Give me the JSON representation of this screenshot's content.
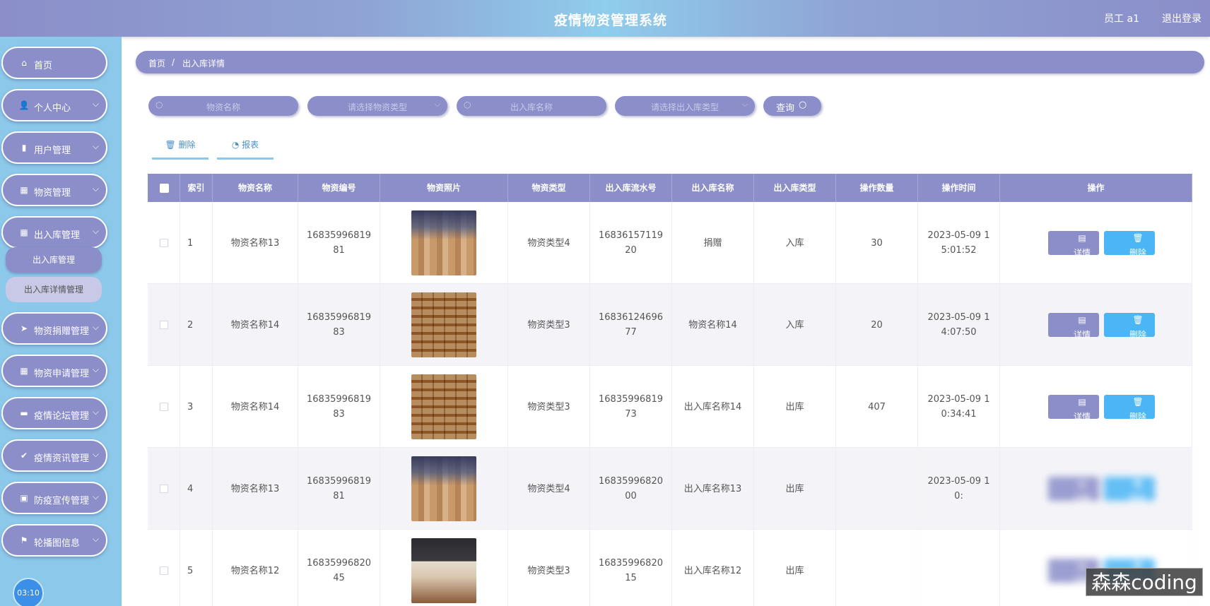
{
  "header": {
    "title": "疫情物资管理系统",
    "user": "员工 a1",
    "logout": "退出登录"
  },
  "sidebar": {
    "items": [
      {
        "label": "首页",
        "icon": "home-icon",
        "glyph": "⌂",
        "has_children": false
      },
      {
        "label": "个人中心",
        "icon": "person-icon",
        "glyph": "👤",
        "has_children": true
      },
      {
        "label": "用户管理",
        "icon": "bar-chart-icon",
        "glyph": "▮",
        "has_children": true
      },
      {
        "label": "物资管理",
        "icon": "grid-icon",
        "glyph": "▦",
        "has_children": true
      },
      {
        "label": "出入库管理",
        "icon": "grid-icon",
        "glyph": "▦",
        "has_children": true
      },
      {
        "label": "物资捐赠管理",
        "icon": "send-icon",
        "glyph": "➤",
        "has_children": true
      },
      {
        "label": "物资申请管理",
        "icon": "grid-icon",
        "glyph": "▦",
        "has_children": true
      },
      {
        "label": "疫情论坛管理",
        "icon": "monitor-icon",
        "glyph": "▬",
        "has_children": true
      },
      {
        "label": "疫情资讯管理",
        "icon": "thumb-icon",
        "glyph": "✔",
        "has_children": true
      },
      {
        "label": "防疫宣传管理",
        "icon": "briefcase-icon",
        "glyph": "▣",
        "has_children": true
      },
      {
        "label": "轮播图信息",
        "icon": "flag-icon",
        "glyph": "⚑",
        "has_children": true
      }
    ],
    "submenu": {
      "active": "出入库管理",
      "selected": "出入库详情管理"
    },
    "clock": "03:10"
  },
  "breadcrumb": {
    "home": "首页",
    "sep": "/",
    "current": "出入库详情"
  },
  "search": {
    "material_name_placeholder": "物资名称",
    "material_type_placeholder": "请选择物资类型",
    "io_name_placeholder": "出入库名称",
    "io_type_placeholder": "请选择出入库类型",
    "query_label": "查询"
  },
  "toolbar": {
    "delete_label": "删除",
    "report_label": "报表"
  },
  "table": {
    "columns": [
      "索引",
      "物资名称",
      "物资编号",
      "物资照片",
      "物资类型",
      "出入库流水号",
      "出入库名称",
      "出入库类型",
      "操作数量",
      "操作时间",
      "操作"
    ],
    "rows": [
      {
        "index": "1",
        "name": "物资名称13",
        "code": "1683599681981",
        "photo": "p1",
        "type": "物资类型4",
        "serial": "1683615711920",
        "io_name": "捐赠",
        "io_type": "入库",
        "qty": "30",
        "time": "2023-05-09 15:01:52",
        "blurred": false
      },
      {
        "index": "2",
        "name": "物资名称14",
        "code": "1683599681983",
        "photo": "p2",
        "type": "物资类型3",
        "serial": "1683612469677",
        "io_name": "物资名称14",
        "io_type": "入库",
        "qty": "20",
        "time": "2023-05-09 14:07:50",
        "blurred": false
      },
      {
        "index": "3",
        "name": "物资名称14",
        "code": "1683599681983",
        "photo": "p2",
        "type": "物资类型3",
        "serial": "1683599681973",
        "io_name": "出入库名称14",
        "io_type": "出库",
        "qty": "407",
        "time": "2023-05-09 10:34:41",
        "blurred": false
      },
      {
        "index": "4",
        "name": "物资名称13",
        "code": "1683599681981",
        "photo": "p1",
        "type": "物资类型4",
        "serial": "1683599682000",
        "io_name": "出入库名称13",
        "io_type": "出库",
        "qty": "",
        "time": "2023-05-09 10:",
        "blurred": true
      },
      {
        "index": "5",
        "name": "物资名称12",
        "code": "1683599682045",
        "photo": "p3",
        "type": "物资类型3",
        "serial": "1683599682015",
        "io_name": "出入库名称12",
        "io_type": "出库",
        "qty": "",
        "time": "",
        "blurred": true
      }
    ],
    "detail_label": "详情",
    "delete_label": "删除"
  },
  "watermark": "森森coding"
}
